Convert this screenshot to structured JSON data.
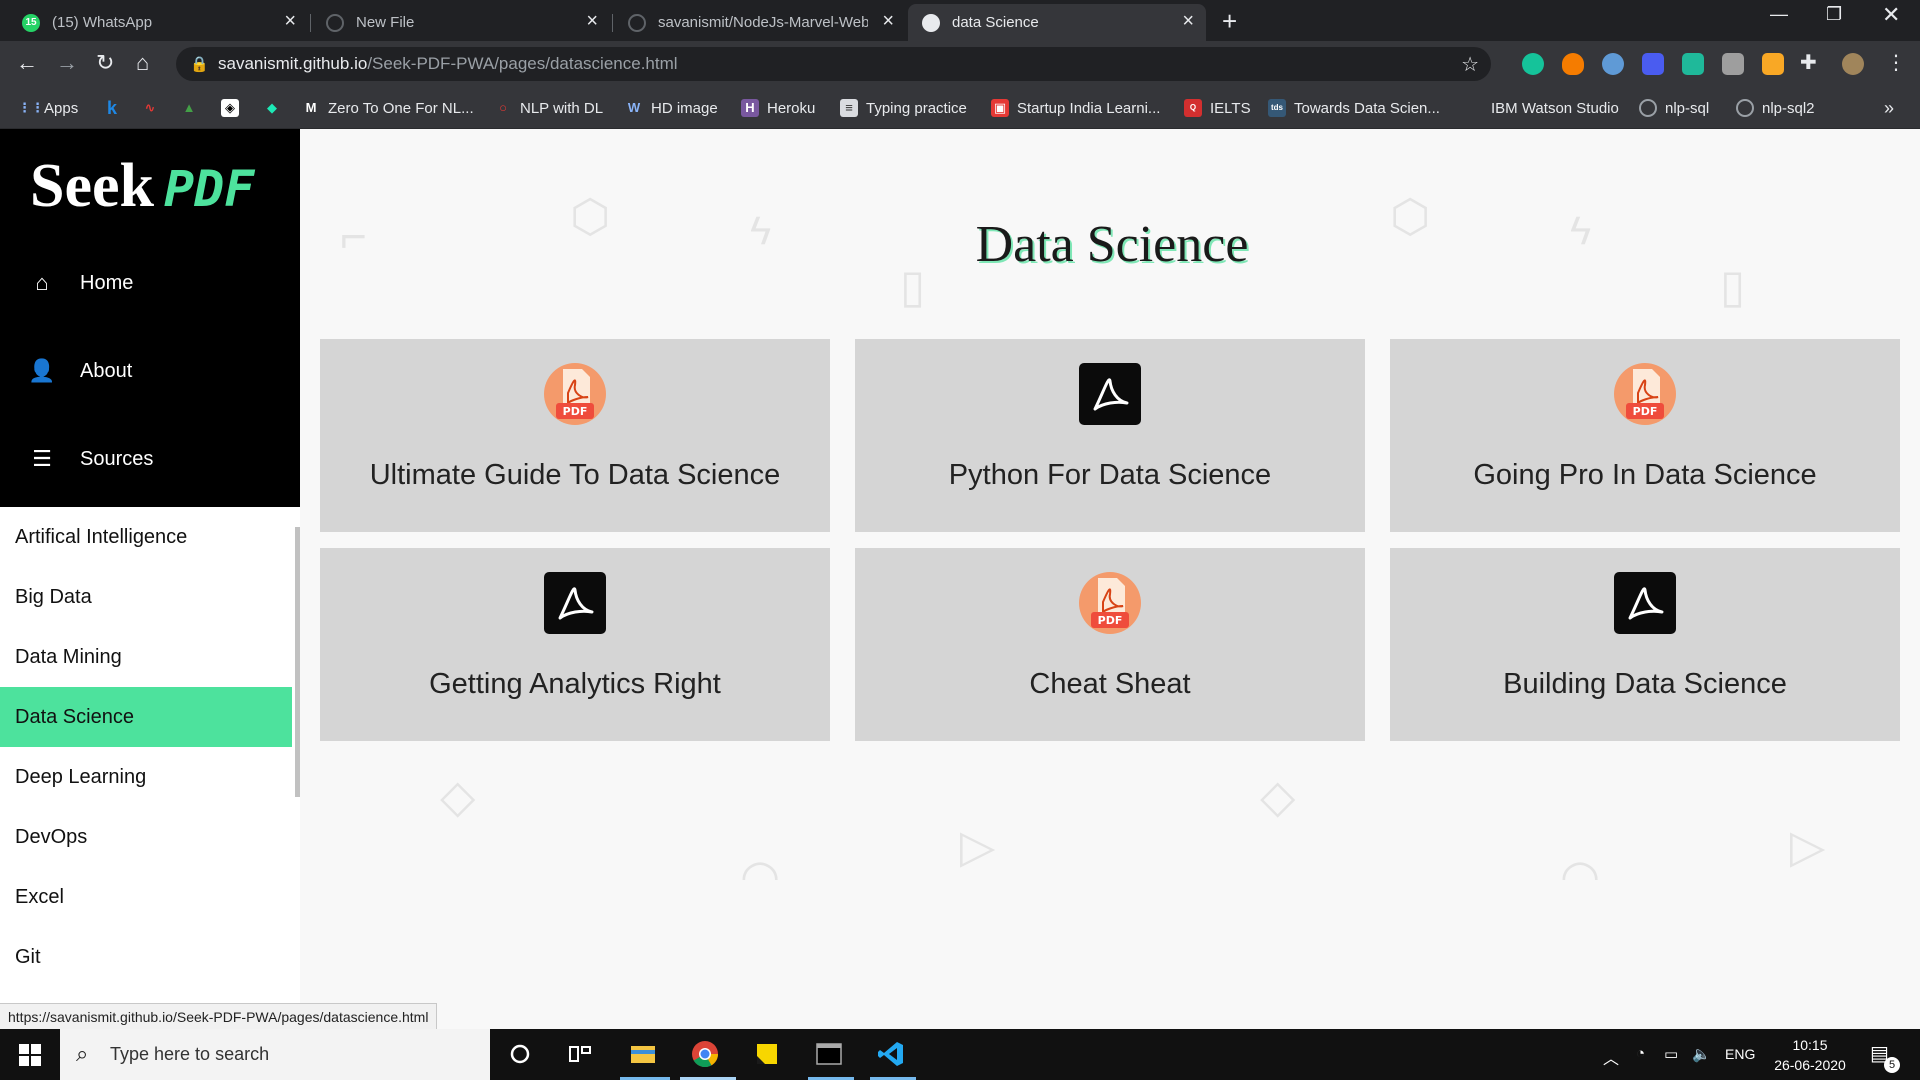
{
  "browser": {
    "tabs": [
      {
        "label": "(15) WhatsApp",
        "badge": "15",
        "active": false
      },
      {
        "label": "New File",
        "active": false
      },
      {
        "label": "savanismit/NodeJs-Marvel-Webs",
        "active": false
      },
      {
        "label": "data Science",
        "active": true
      }
    ],
    "url_domain": "savanismit.github.io",
    "url_path": "/Seek-PDF-PWA/pages/datascience.html",
    "bookmarks": [
      {
        "label": "Apps",
        "icon": "apps-grid-icon"
      },
      {
        "label": "",
        "icon": "k-icon"
      },
      {
        "label": "",
        "icon": "chart-icon"
      },
      {
        "label": "",
        "icon": "mountain-icon"
      },
      {
        "label": "",
        "icon": "codepen-icon"
      },
      {
        "label": "",
        "icon": "leaf-icon"
      },
      {
        "label": "Zero To One For NL...",
        "icon": "medium-icon"
      },
      {
        "label": "NLP with DL",
        "icon": "refresh-icon"
      },
      {
        "label": "HD image",
        "icon": "unsplash-icon"
      },
      {
        "label": "Heroku",
        "icon": "heroku-icon"
      },
      {
        "label": "Typing practice",
        "icon": "doc-icon"
      },
      {
        "label": "Startup India Learni...",
        "icon": "startup-icon"
      },
      {
        "label": "IELTS",
        "icon": "ielts-icon"
      },
      {
        "label": "Towards Data Scien...",
        "icon": "tds-icon"
      },
      {
        "label": "IBM Watson Studio",
        "icon": "ibm-icon"
      },
      {
        "label": "nlp-sql",
        "icon": "github-icon"
      },
      {
        "label": "nlp-sql2",
        "icon": "github-icon"
      }
    ],
    "more_bookmarks": "»"
  },
  "app": {
    "logo_main": "Seek",
    "logo_accent": "PDF",
    "nav": [
      {
        "label": "Home",
        "icon": "home-icon"
      },
      {
        "label": "About",
        "icon": "user-icon"
      },
      {
        "label": "Sources",
        "icon": "database-icon"
      }
    ],
    "categories": [
      {
        "label": "Artifical Intelligence",
        "active": false
      },
      {
        "label": "Big Data",
        "active": false
      },
      {
        "label": "Data Mining",
        "active": false
      },
      {
        "label": "Data Science",
        "active": true
      },
      {
        "label": "Deep Learning",
        "active": false
      },
      {
        "label": "DevOps",
        "active": false
      },
      {
        "label": "Excel",
        "active": false
      },
      {
        "label": "Git",
        "active": false
      }
    ],
    "page_title": "Data Science",
    "cards": [
      {
        "title": "Ultimate Guide To Data Science",
        "icon_style": "orange-pdf",
        "icon_text": "PDF"
      },
      {
        "title": "Python For Data Science",
        "icon_style": "black-acrobat"
      },
      {
        "title": "Going Pro In Data Science",
        "icon_style": "orange-pdf",
        "icon_text": "PDF"
      },
      {
        "title": "Getting Analytics Right",
        "icon_style": "black-acrobat"
      },
      {
        "title": "Cheat Sheat",
        "icon_style": "orange-pdf",
        "icon_text": "PDF"
      },
      {
        "title": "Building Data Science",
        "icon_style": "black-acrobat"
      }
    ],
    "status_url": "https://savanismit.github.io/Seek-PDF-PWA/pages/datascience.html"
  },
  "taskbar": {
    "search_placeholder": "Type here to search",
    "language": "ENG",
    "time": "10:15",
    "date": "26-06-2020",
    "notification_count": "5"
  },
  "colors": {
    "accent": "#4de29d",
    "sidebar_bg": "#000000",
    "card_bg": "#d5d5d5"
  }
}
